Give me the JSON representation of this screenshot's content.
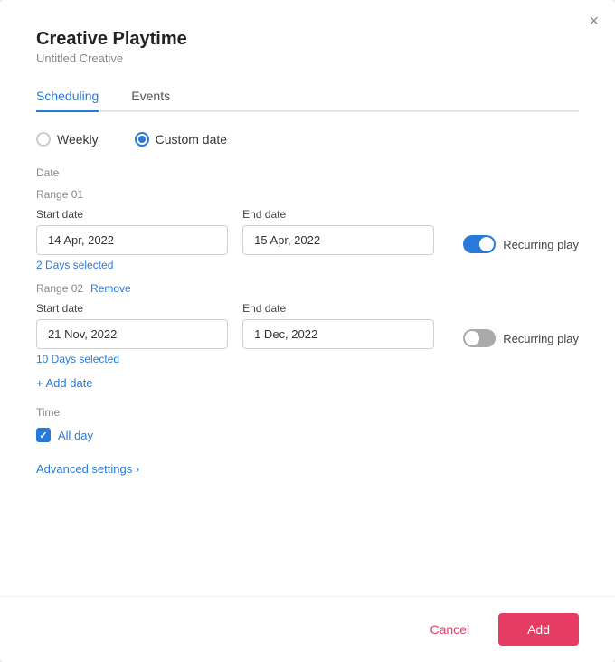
{
  "modal": {
    "title": "Creative Playtime",
    "subtitle": "Untitled Creative",
    "close_label": "×"
  },
  "tabs": [
    {
      "id": "scheduling",
      "label": "Scheduling",
      "active": true
    },
    {
      "id": "events",
      "label": "Events",
      "active": false
    }
  ],
  "frequency": {
    "weekly_label": "Weekly",
    "custom_label": "Custom date",
    "selected": "custom"
  },
  "date_section_label": "Date",
  "ranges": [
    {
      "id": "range-01",
      "header": "Range 01",
      "start_label": "Start date",
      "start_value": "14 Apr, 2022",
      "end_label": "End date",
      "end_value": "15 Apr, 2022",
      "recurring_on": true,
      "recurring_label": "Recurring play",
      "days_selected": "2 Days selected",
      "show_remove": false
    },
    {
      "id": "range-02",
      "header": "Range 02",
      "remove_label": "Remove",
      "start_label": "Start date",
      "start_value": "21 Nov, 2022",
      "end_label": "End date",
      "end_value": "1 Dec, 2022",
      "recurring_on": false,
      "recurring_label": "Recurring play",
      "days_selected": "10 Days selected",
      "show_remove": true
    }
  ],
  "add_date_label": "+ Add date",
  "time_section_label": "Time",
  "allday_label": "All day",
  "advanced_label": "Advanced settings ›",
  "footer": {
    "cancel_label": "Cancel",
    "add_label": "Add"
  }
}
